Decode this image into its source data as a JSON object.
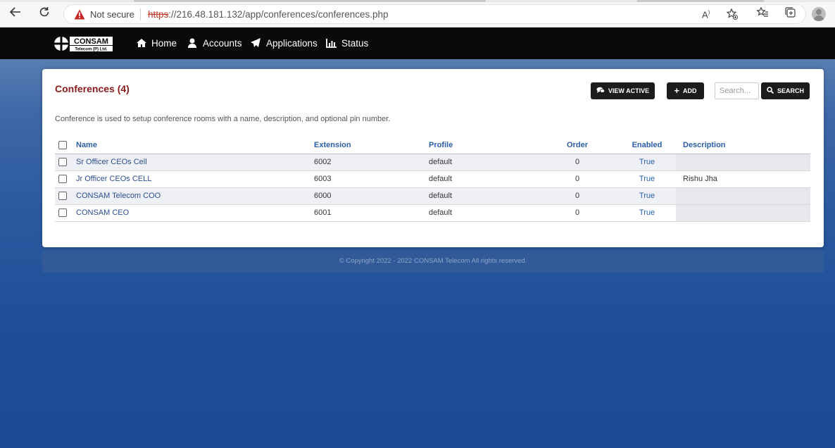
{
  "browser": {
    "security_label": "Not secure",
    "url_scheme": "https",
    "url_rest": "://216.48.181.132/app/conferences/conferences.php"
  },
  "navbar": {
    "brand": "CONSAM",
    "brand_sub": "Telecom (P) Ltd.",
    "items": [
      {
        "label": "Home",
        "icon": "home-icon"
      },
      {
        "label": "Accounts",
        "icon": "user-icon"
      },
      {
        "label": "Applications",
        "icon": "paper-plane-icon"
      },
      {
        "label": "Status",
        "icon": "bar-chart-icon"
      }
    ]
  },
  "page": {
    "title": "Conferences (4)",
    "description": "Conference is used to setup conference rooms with a name, description, and optional pin number.",
    "buttons": {
      "view_active": "VIEW ACTIVE",
      "add": "ADD",
      "search": "SEARCH"
    },
    "search_placeholder": "Search..."
  },
  "table": {
    "headers": {
      "name": "Name",
      "extension": "Extension",
      "profile": "Profile",
      "order": "Order",
      "enabled": "Enabled",
      "description": "Description"
    },
    "rows": [
      {
        "name": "Sr Officer CEOs Cell",
        "extension": "6002",
        "profile": "default",
        "order": "0",
        "enabled": "True",
        "description": ""
      },
      {
        "name": "Jr Officer CEOs CELL",
        "extension": "6003",
        "profile": "default",
        "order": "0",
        "enabled": "True",
        "description": "Rishu Jha"
      },
      {
        "name": "CONSAM Telecom COO",
        "extension": "6000",
        "profile": "default",
        "order": "0",
        "enabled": "True",
        "description": ""
      },
      {
        "name": "CONSAM CEO",
        "extension": "6001",
        "profile": "default",
        "order": "0",
        "enabled": "True",
        "description": ""
      }
    ]
  },
  "footer": {
    "copyright": "© Copyright 2022 - 2022 CONSAM Telecom All rights reserved."
  },
  "colors": {
    "navbar_bg": "#0a0a0a",
    "title_red": "#8b1a1a",
    "link_blue": "#2a5ea8",
    "button_dark": "#1c1c1c"
  }
}
